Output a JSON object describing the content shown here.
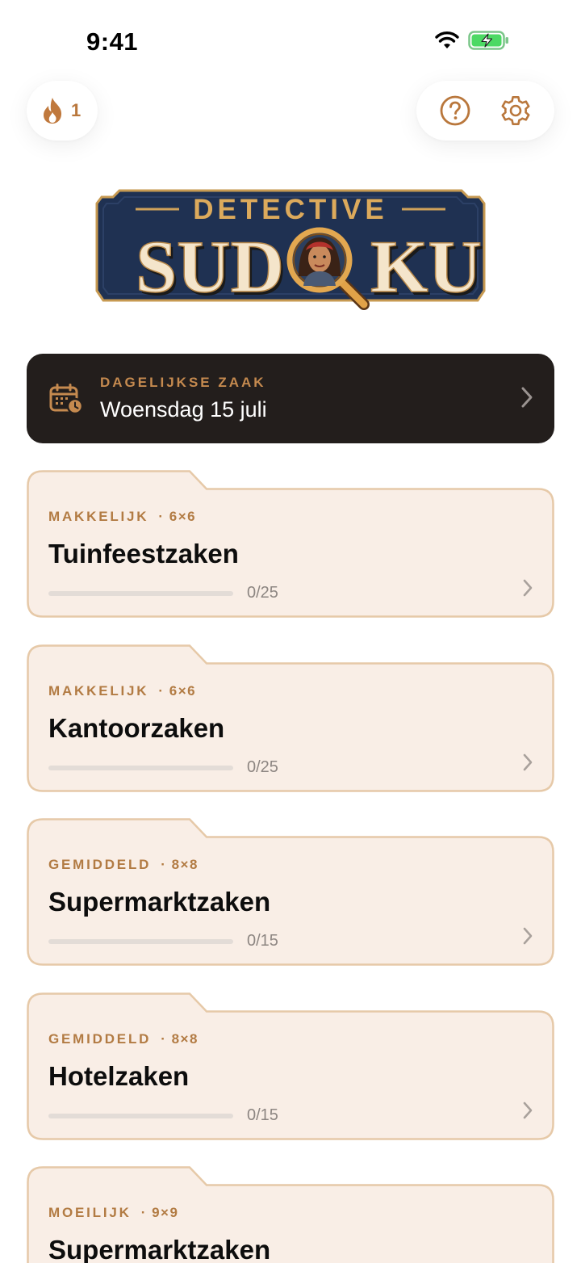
{
  "status": {
    "time": "9:41"
  },
  "streak": {
    "count": "1",
    "icon": "flame-icon"
  },
  "header": {
    "help_icon": "question-circle-icon",
    "settings_icon": "gear-icon"
  },
  "logo": {
    "line1": "DETECTIVE",
    "line2_left": "SUD",
    "line2_right": "KU"
  },
  "daily": {
    "eyebrow": "DAGELIJKSE ZAAK",
    "date": "Woensdag 15 juli",
    "icon": "calendar-clock-icon"
  },
  "colors": {
    "accent": "#b27b43",
    "dark_card": "#231e1c",
    "folder_bg": "#f9eee6",
    "folder_border": "#e6c9a8"
  },
  "cases": [
    {
      "difficulty": "MAKKELIJK",
      "grid": "· 6×6",
      "title": "Tuinfeestzaken",
      "progress": "0/25",
      "solved_fraction": 0
    },
    {
      "difficulty": "MAKKELIJK",
      "grid": "· 6×6",
      "title": "Kantoorzaken",
      "progress": "0/25",
      "solved_fraction": 0
    },
    {
      "difficulty": "GEMIDDELD",
      "grid": "· 8×8",
      "title": "Supermarktzaken",
      "progress": "0/15",
      "solved_fraction": 0
    },
    {
      "difficulty": "GEMIDDELD",
      "grid": "· 8×8",
      "title": "Hotelzaken",
      "progress": "0/15",
      "solved_fraction": 0
    },
    {
      "difficulty": "MOEILIJK",
      "grid": "· 9×9",
      "title": "Supermarktzaken",
      "progress": "",
      "solved_fraction": 0
    }
  ]
}
